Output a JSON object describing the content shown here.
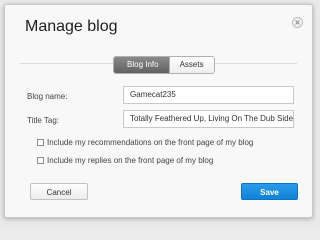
{
  "dialog": {
    "title": "Manage blog",
    "close_icon": "close-icon"
  },
  "tabs": [
    {
      "label": "Blog Info",
      "active": true
    },
    {
      "label": "Assets",
      "active": false
    }
  ],
  "form": {
    "blog_name": {
      "label": "Blog name:",
      "value": "Gamecat235"
    },
    "title_tag": {
      "label": "Title Tag:",
      "value": "Totally Feathered Up, Living On The Dub Side"
    },
    "checkboxes": [
      {
        "label": "Include my recommendations on the front page of my blog",
        "checked": false
      },
      {
        "label": "Include my replies on the front page of my blog",
        "checked": false
      }
    ]
  },
  "buttons": {
    "cancel_label": "Cancel",
    "save_label": "Save"
  },
  "colors": {
    "save_button": "#1a8fe3",
    "active_tab": "#6f6f6f"
  }
}
